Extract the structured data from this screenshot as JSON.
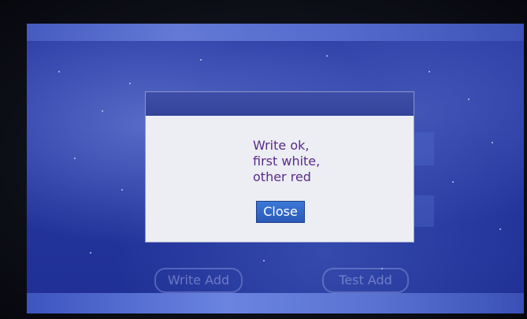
{
  "dialog": {
    "message_lines": [
      "Write ok,",
      "first white,",
      "other red"
    ],
    "close_label": "Close"
  },
  "background": {
    "write_add_label": "Write Add",
    "test_add_label": "Test Add"
  },
  "colors": {
    "dialog_bg": "#eceef3",
    "dialog_header": "#3e4ea8",
    "message_text": "#5a2a8a",
    "close_button": "#2f66c4",
    "screen_bg": "#2536a0"
  }
}
